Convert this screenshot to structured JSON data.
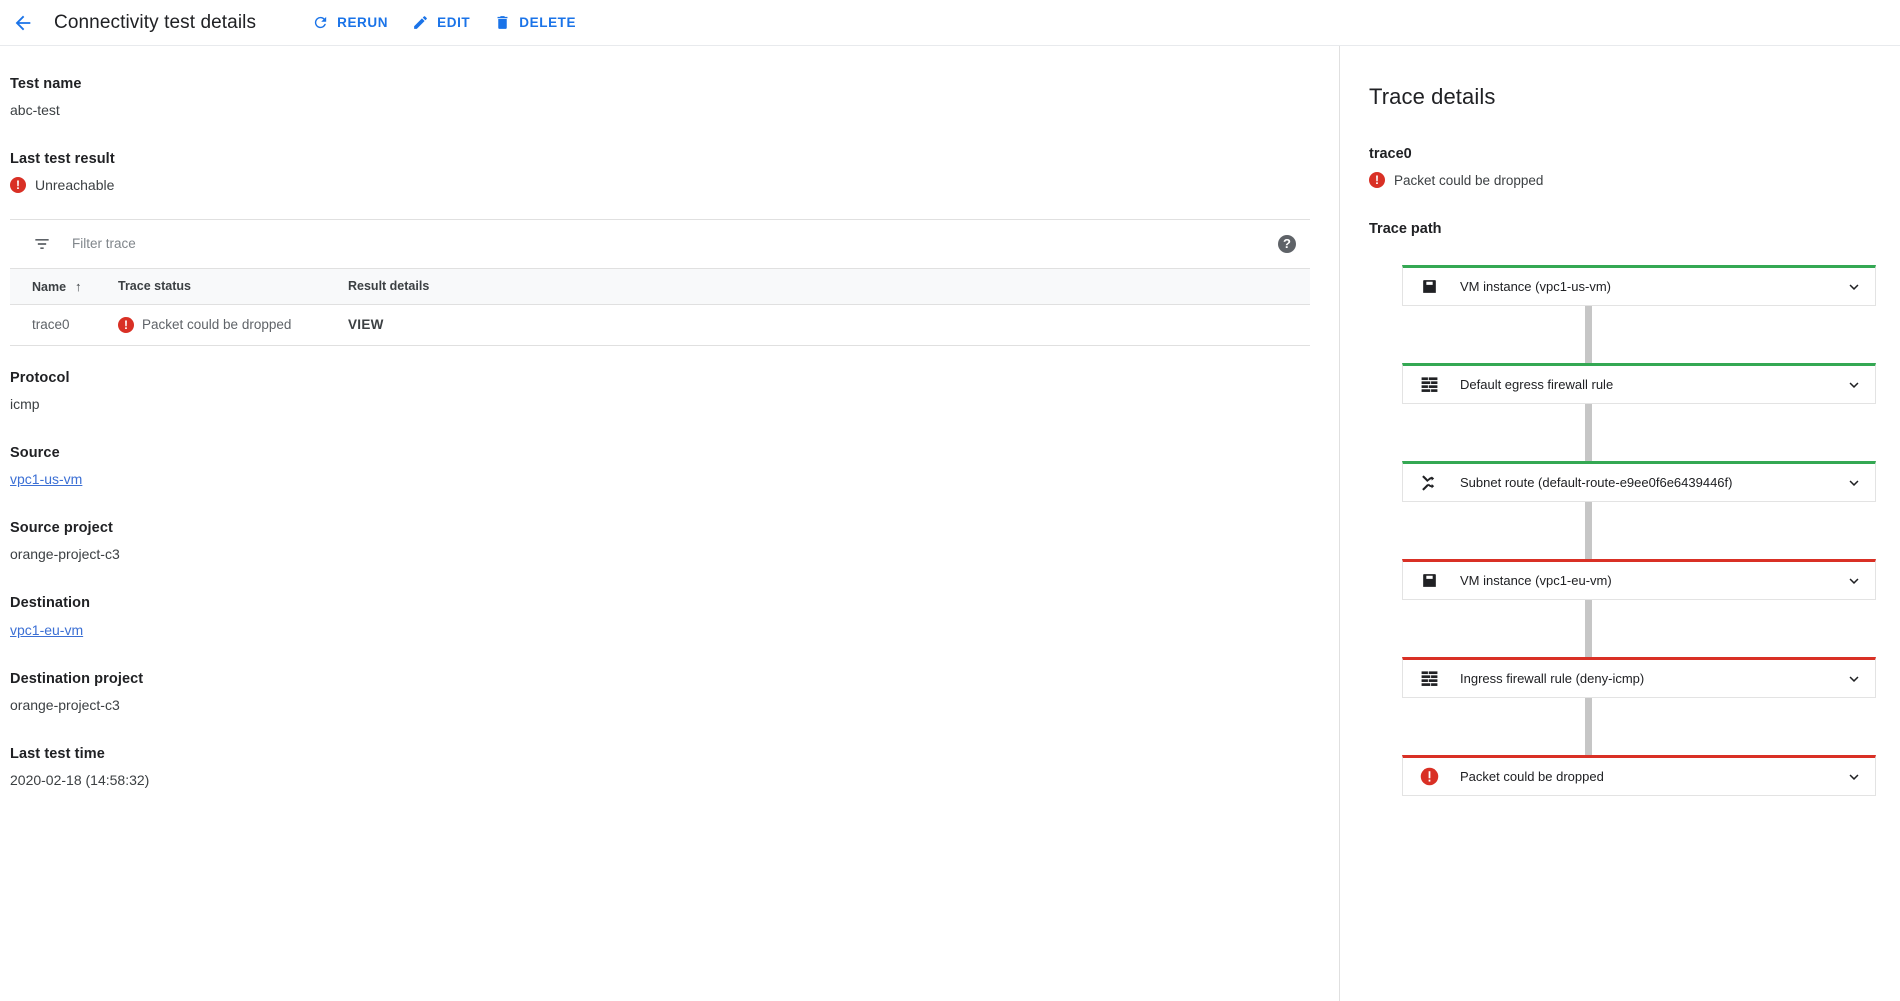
{
  "topbar": {
    "back_label": "back-arrow",
    "title": "Connectivity test details",
    "actions": [
      {
        "icon": "refresh-icon",
        "label": "RERUN"
      },
      {
        "icon": "pencil-icon",
        "label": "EDIT"
      },
      {
        "icon": "trash-icon",
        "label": "DELETE"
      }
    ]
  },
  "left": {
    "test_name_label": "Test name",
    "test_name_value": "abc-test",
    "last_result_label": "Last test result",
    "last_result_value": "Unreachable",
    "filter_placeholder": "Filter trace",
    "filter_value": "",
    "help_glyph": "?",
    "table": {
      "columns": [
        "Name",
        "Trace status",
        "Result details"
      ],
      "sort_column": "Name",
      "sort_arrow": "↑",
      "rows": [
        {
          "name": "trace0",
          "status": "Packet could be dropped",
          "result": "VIEW"
        }
      ]
    },
    "protocol_label": "Protocol",
    "protocol_value": "icmp",
    "source_label": "Source",
    "source_value": "vpc1-us-vm",
    "source_project_label": "Source project",
    "source_project_value": "orange-project-c3",
    "destination_label": "Destination",
    "destination_value": "vpc1-eu-vm",
    "destination_project_label": "Destination project",
    "destination_project_value": "orange-project-c3",
    "last_test_time_label": "Last test time",
    "last_test_time_value": "2020-02-18 (14:58:32)"
  },
  "right": {
    "title": "Trace details",
    "trace_name": "trace0",
    "trace_status": "Packet could be dropped",
    "path_title": "Trace path",
    "path": [
      {
        "icon": "vm-instance-icon",
        "label": "VM instance (vpc1-us-vm)",
        "state": "ok"
      },
      {
        "icon": "firewall-icon",
        "label": "Default egress firewall rule",
        "state": "ok"
      },
      {
        "icon": "route-icon",
        "label": "Subnet route (default-route-e9ee0f6e6439446f)",
        "state": "ok"
      },
      {
        "icon": "vm-instance-icon",
        "label": "VM instance (vpc1-eu-vm)",
        "state": "fail"
      },
      {
        "icon": "firewall-icon",
        "label": "Ingress firewall rule (deny-icmp)",
        "state": "fail"
      },
      {
        "icon": "error-icon",
        "label": "Packet could be dropped",
        "state": "fail"
      }
    ]
  },
  "colors": {
    "accent_blue": "#1a73e8",
    "link_blue": "#3b6fd4",
    "error_red": "#d93025",
    "success_green": "#34a853",
    "connector_gray": "#c6c6c6"
  }
}
